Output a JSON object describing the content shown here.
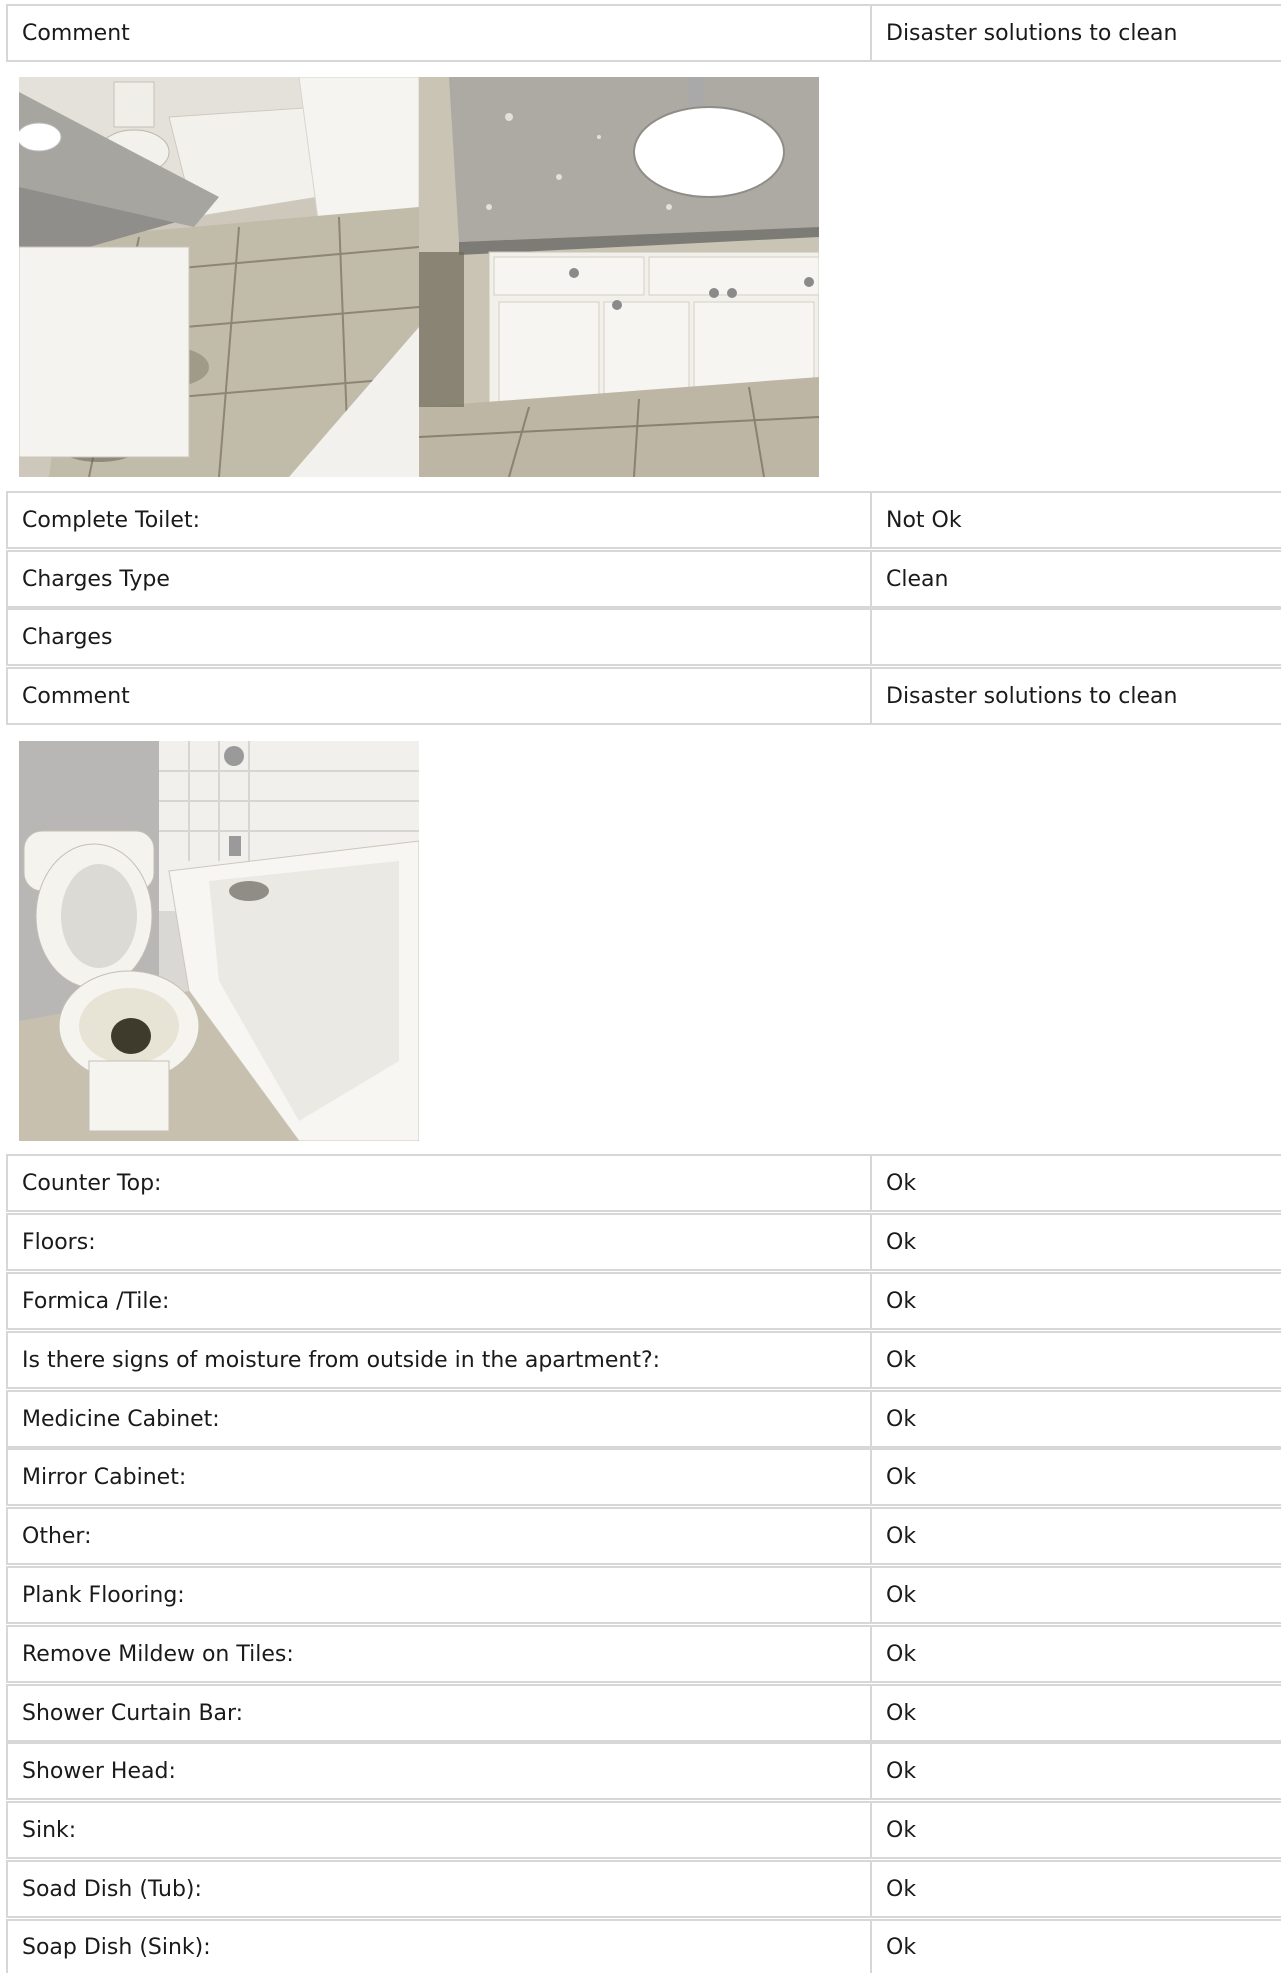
{
  "sections": {
    "top_comment": {
      "label": "Comment",
      "value": "Disaster solutions to clean"
    },
    "toilet": [
      {
        "label": "Complete Toilet:",
        "value": "Not Ok"
      },
      {
        "label": "Charges Type",
        "value": "Clean"
      },
      {
        "label": "Charges",
        "value": ""
      },
      {
        "label": "Comment",
        "value": "Disaster solutions to clean"
      }
    ],
    "checklist": [
      {
        "label": "Counter Top:",
        "value": "Ok"
      },
      {
        "label": "Floors:",
        "value": "Ok"
      },
      {
        "label": "Formica /Tile:",
        "value": "Ok"
      },
      {
        "label": "Is there signs of moisture from outside in the apartment?:",
        "value": "Ok"
      },
      {
        "label": "Medicine Cabinet:",
        "value": "Ok"
      },
      {
        "label": "Mirror Cabinet:",
        "value": "Ok"
      },
      {
        "label": "Other:",
        "value": "Ok"
      },
      {
        "label": "Plank Flooring:",
        "value": "Ok"
      },
      {
        "label": "Remove Mildew on Tiles:",
        "value": "Ok"
      },
      {
        "label": "Shower Curtain Bar:",
        "value": "Ok"
      },
      {
        "label": "Shower Head:",
        "value": "Ok"
      },
      {
        "label": "Sink:",
        "value": "Ok"
      },
      {
        "label": "Soad Dish (Tub):",
        "value": "Ok"
      },
      {
        "label": "Soap Dish (Sink):",
        "value": "Ok"
      }
    ]
  },
  "photos": [
    {
      "name": "bathroom-floor-photo",
      "subject": "bathroom floor with vanity and toilet"
    },
    {
      "name": "vanity-cabinet-photo",
      "subject": "vanity countertop and cabinet"
    },
    {
      "name": "toilet-tub-photo",
      "subject": "toilet and bathtub"
    }
  ],
  "colors": {
    "border": "#d7d7d7",
    "text": "#1a1a1a",
    "background": "#ffffff"
  }
}
